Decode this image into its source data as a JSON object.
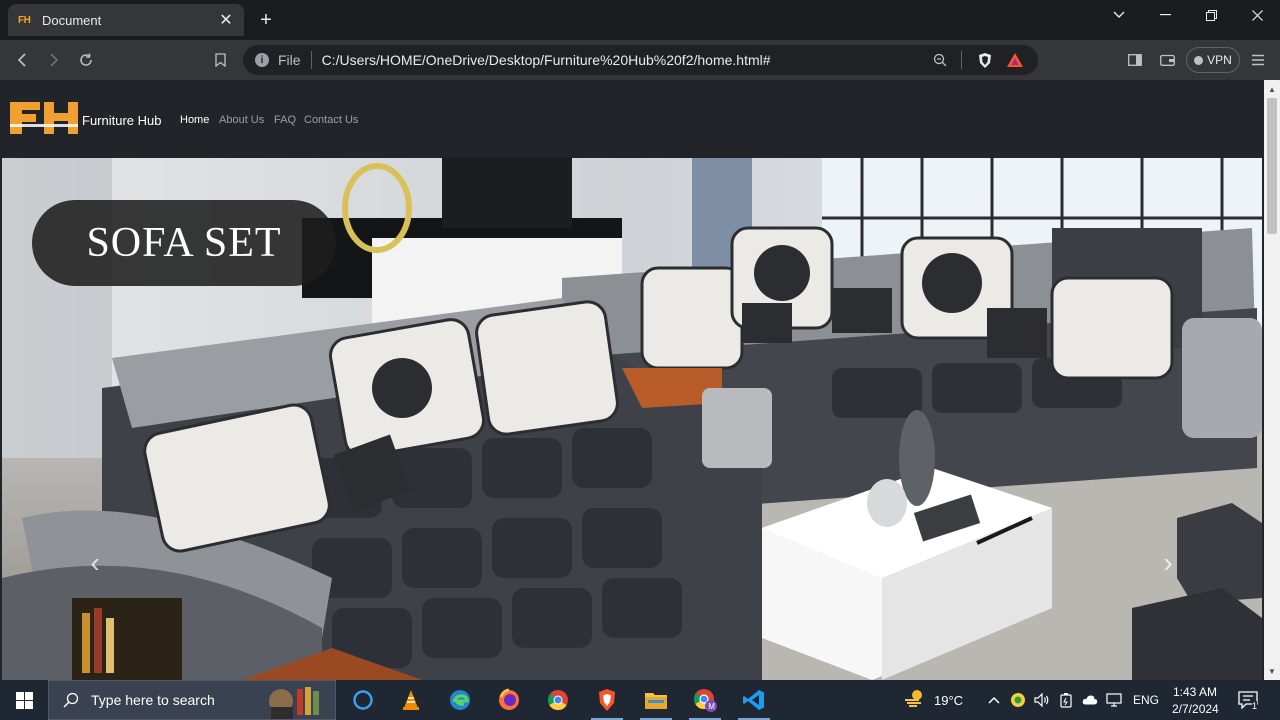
{
  "browser": {
    "tab": {
      "favicon": "FH",
      "title": "Document",
      "close": "✕"
    },
    "new_tab": "+",
    "url_scheme": "File",
    "url": "C:/Users/HOME/OneDrive/Desktop/Furniture%20Hub%20f2/home.html#",
    "vpn_label": "VPN"
  },
  "site": {
    "brand": "Furniture Hub",
    "nav": [
      {
        "label": "Home",
        "active": true
      },
      {
        "label": "About Us",
        "active": false
      },
      {
        "label": "FAQ",
        "active": false
      },
      {
        "label": "Contact Us",
        "active": false
      }
    ],
    "hero": {
      "title": "SOFA SET",
      "prev": "‹",
      "next": "›"
    },
    "logo_color": "#f0a030"
  },
  "taskbar": {
    "search_placeholder": "Type here to search",
    "weather_temp": "19°C",
    "language": "ENG",
    "time": "1:43 AM",
    "date": "2/7/2024",
    "notification_count": "1"
  }
}
